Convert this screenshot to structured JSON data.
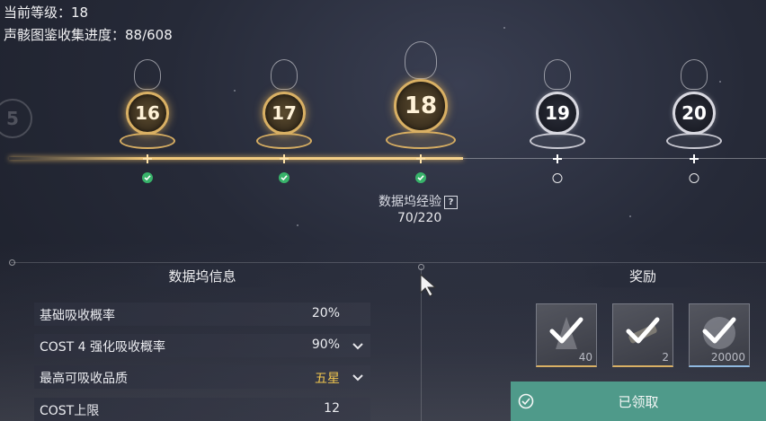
{
  "header": {
    "level_line": "当前等级：18",
    "collection_line": "声骸图鉴收集进度：88/608"
  },
  "levels": [
    {
      "number": "16",
      "state": "claimed"
    },
    {
      "number": "17",
      "state": "claimed"
    },
    {
      "number": "18",
      "state": "claimed"
    },
    {
      "number": "19",
      "state": "locked"
    },
    {
      "number": "20",
      "state": "locked"
    }
  ],
  "experience": {
    "label": "数据坞经验",
    "help_glyph": "?",
    "value": "70/220"
  },
  "info_panel": {
    "title": "数据坞信息",
    "stats": [
      {
        "label": "基础吸收概率",
        "value": "20%"
      },
      {
        "label": "COST 4 强化吸收概率",
        "value": "90%"
      },
      {
        "label": "最高可吸收品质",
        "value": "五星"
      },
      {
        "label": "COST上限",
        "value": "12"
      }
    ]
  },
  "rewards": {
    "title": "奖励",
    "items": [
      {
        "count": "40",
        "icon": "shell-credit-icon"
      },
      {
        "count": "2",
        "icon": "tuner-icon"
      },
      {
        "count": "20000",
        "icon": "coin-icon"
      }
    ],
    "claim_label": "已领取"
  },
  "colors": {
    "gold": "#d9b064",
    "claim_green": "#4f9a8a",
    "check_green": "#38b36a",
    "highlight_value": "#f1c64e"
  }
}
